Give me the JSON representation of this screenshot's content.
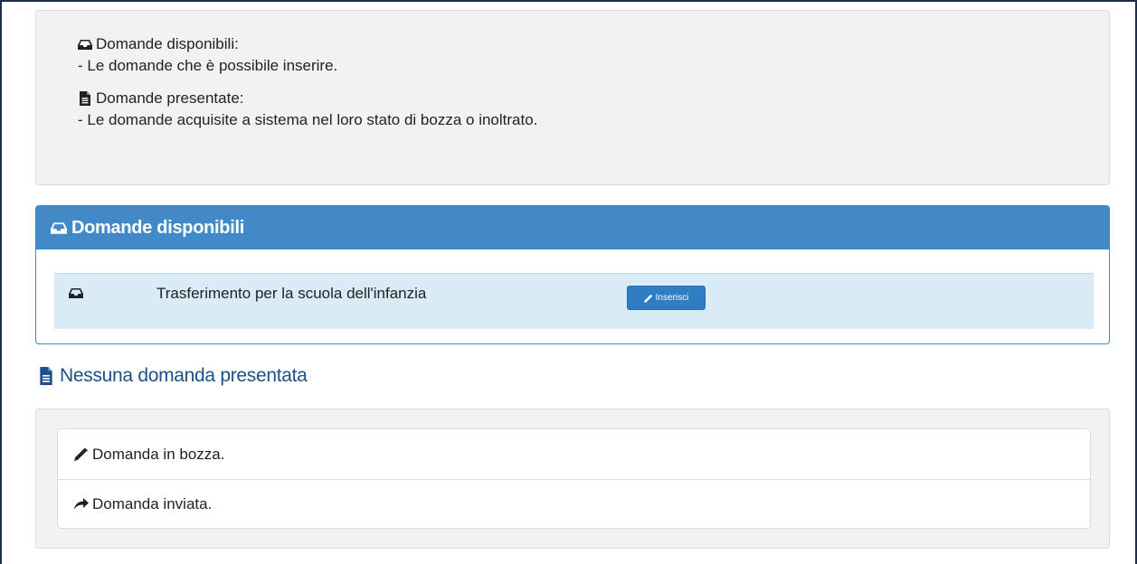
{
  "info": {
    "available_title": "Domande disponibili:",
    "available_desc": "- Le domande che è possibile inserire.",
    "submitted_title": "Domande presentate:",
    "submitted_desc": "- Le domande acquisite a sistema nel loro stato di bozza o inoltrato."
  },
  "panel": {
    "title": "Domande disponibili",
    "rows": [
      {
        "label": "Trasferimento per la scuola dell'infanzia",
        "button": "Inserisci"
      }
    ]
  },
  "section": {
    "title": "Nessuna domanda presentata"
  },
  "legend": {
    "items": [
      {
        "icon": "pencil-icon",
        "label": "Domanda in bozza."
      },
      {
        "icon": "share-icon",
        "label": "Domanda inviata."
      }
    ]
  },
  "colors": {
    "panel_header": "#4189c7",
    "row_background": "#d9ebf6",
    "button": "#2f7ec3",
    "section_title": "#1c4f8c"
  }
}
